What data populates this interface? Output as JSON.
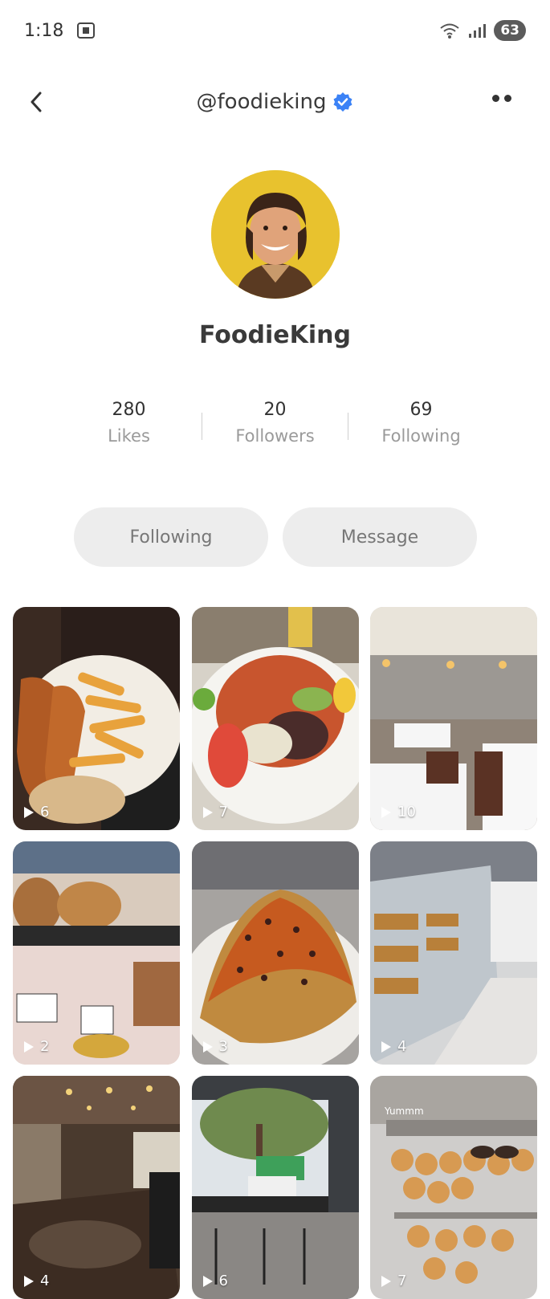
{
  "status_bar": {
    "time": "1:18",
    "battery": "63",
    "icons": [
      "screenshot-icon",
      "wifi-icon",
      "signal-icon",
      "battery-icon"
    ]
  },
  "header": {
    "handle": "@foodieking",
    "verified": true,
    "accent": "#3b82f6"
  },
  "profile": {
    "display_name": "FoodieKing"
  },
  "stats": [
    {
      "value": "280",
      "label": "Likes"
    },
    {
      "value": "20",
      "label": "Followers"
    },
    {
      "value": "69",
      "label": "Following"
    }
  ],
  "actions": {
    "following_label": "Following",
    "message_label": "Message"
  },
  "videos": [
    {
      "count": "6",
      "subject": "fried-chicken-fries"
    },
    {
      "count": "7",
      "subject": "salad-plate"
    },
    {
      "count": "10",
      "subject": "restaurant-dining-room"
    },
    {
      "count": "2",
      "subject": "bakery-case"
    },
    {
      "count": "3",
      "subject": "rice-dish"
    },
    {
      "count": "4",
      "subject": "bakery-counter"
    },
    {
      "count": "4",
      "subject": "cafe-interior"
    },
    {
      "count": "6",
      "subject": "street-view"
    },
    {
      "count": "7",
      "subject": "donut-display"
    }
  ],
  "tile_overlay_text": "Yummm"
}
